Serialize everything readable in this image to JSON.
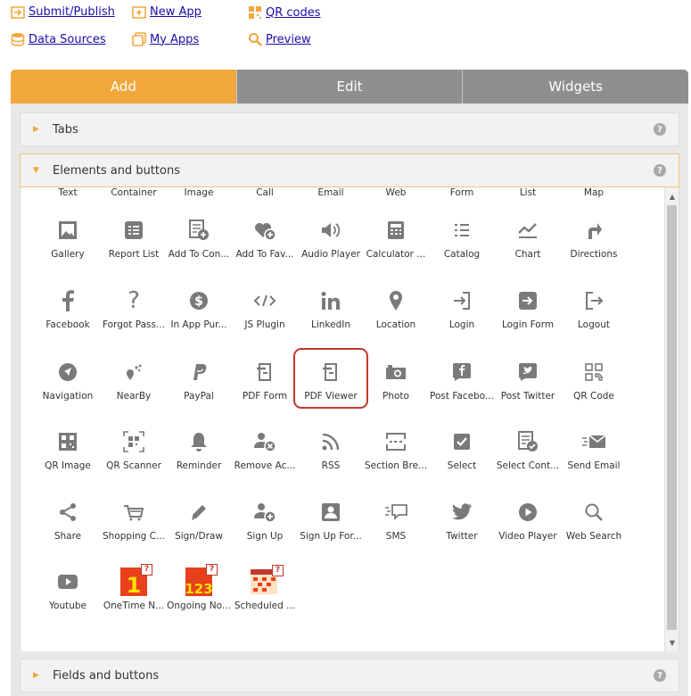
{
  "top_links": {
    "submit": "Submit/Publish",
    "new_app": "New App",
    "qr_codes": "QR codes",
    "data_sources": "Data Sources",
    "my_apps": "My Apps",
    "preview": "Preview"
  },
  "tabs": [
    "Add",
    "Edit",
    "Widgets"
  ],
  "sections": {
    "tabs": "Tabs",
    "elements": "Elements and buttons",
    "fields": "Fields and buttons"
  },
  "help_symbol": "?",
  "grid": {
    "row0": [
      "Text",
      "Container",
      "Image",
      "Call",
      "Email",
      "Web",
      "Form",
      "List",
      "Map"
    ],
    "row1": [
      "Gallery",
      "Report List",
      "Add To Con...",
      "Add To Fav...",
      "Audio Player",
      "Calculator ...",
      "Catalog",
      "Chart",
      "Directions"
    ],
    "row2": [
      "Facebook",
      "Forgot Pass...",
      "In App Pur...",
      "JS Plugin",
      "LinkedIn",
      "Location",
      "Login",
      "Login Form",
      "Logout"
    ],
    "row3": [
      "Navigation",
      "NearBy",
      "PayPal",
      "PDF Form",
      "PDF Viewer",
      "Photo",
      "Post Facebo...",
      "Post Twitter",
      "QR Code"
    ],
    "row4": [
      "QR Image",
      "QR Scanner",
      "Reminder",
      "Remove Ac...",
      "RSS",
      "Section Bre...",
      "Select",
      "Select Cont...",
      "Send Email"
    ],
    "row5": [
      "Share",
      "Shopping C...",
      "Sign/Draw",
      "Sign Up",
      "Sign Up For...",
      "SMS",
      "Twitter",
      "Video Player",
      "Web Search"
    ],
    "row6": [
      "Youtube",
      "OneTime N...",
      "Ongoing No...",
      "Scheduled ..."
    ]
  },
  "icons": {
    "row1": [
      "gallery-icon",
      "report-list-icon",
      "add-to-contacts-icon",
      "add-to-favorites-icon",
      "audio-player-icon",
      "calculator-icon",
      "catalog-icon",
      "chart-icon",
      "directions-icon"
    ],
    "row2": [
      "facebook-icon",
      "question-mark-icon",
      "dollar-icon",
      "code-icon",
      "linkedin-icon",
      "location-pin-icon",
      "login-icon",
      "login-form-icon",
      "logout-icon"
    ],
    "row3": [
      "navigation-icon",
      "nearby-icon",
      "paypal-icon",
      "pdf-form-icon",
      "pdf-viewer-icon",
      "camera-icon",
      "post-facebook-icon",
      "post-twitter-icon",
      "qr-code-icon"
    ],
    "row4": [
      "qr-image-icon",
      "qr-scanner-icon",
      "bell-icon",
      "remove-account-icon",
      "rss-icon",
      "section-break-icon",
      "checkbox-icon",
      "select-contact-icon",
      "send-email-icon"
    ],
    "row5": [
      "share-icon",
      "shopping-cart-icon",
      "pencil-icon",
      "sign-up-icon",
      "sign-up-form-icon",
      "sms-icon",
      "twitter-icon",
      "video-player-icon",
      "search-icon"
    ],
    "row6": [
      "youtube-icon",
      "onetime-notification-icon",
      "ongoing-notification-icon",
      "scheduled-notification-icon"
    ]
  },
  "notif_glyphs": {
    "onetime": "1",
    "ongoing": "123"
  },
  "colors": {
    "accent": "#f2a73b",
    "tab_inactive": "#8f8f8f",
    "link": "#1a0dab",
    "highlight": "#c0392b",
    "icon": "#7a7a7a"
  },
  "selected_item": "PDF Viewer"
}
